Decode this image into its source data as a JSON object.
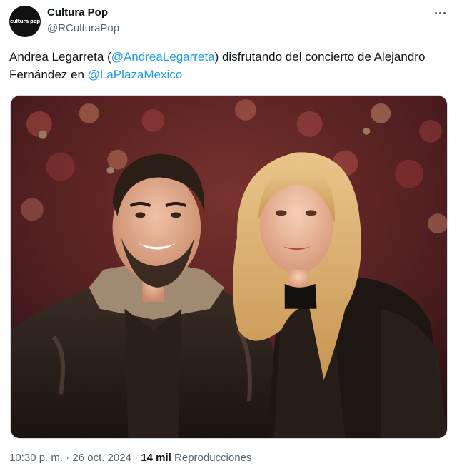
{
  "author": {
    "avatar_text": "cultura pop",
    "display_name": "Cultura Pop",
    "handle": "@RCulturaPop"
  },
  "tweet": {
    "text_part1": "Andrea Legarreta (",
    "mention1": "@AndreaLegarreta",
    "text_part2": ") disfrutando del concierto de Alejandro Fernández en ",
    "mention2": "@LaPlazaMexico"
  },
  "meta": {
    "time": "10:30 p. m.",
    "separator": "·",
    "date": "26 oct. 2024",
    "views_count": "14 mil",
    "views_label": "Reproducciones"
  },
  "colors": {
    "link": "#1d9bf0",
    "secondary_text": "#536471",
    "primary_text": "#0f1419"
  },
  "icons": {
    "more": "more-horizontal-icon"
  }
}
